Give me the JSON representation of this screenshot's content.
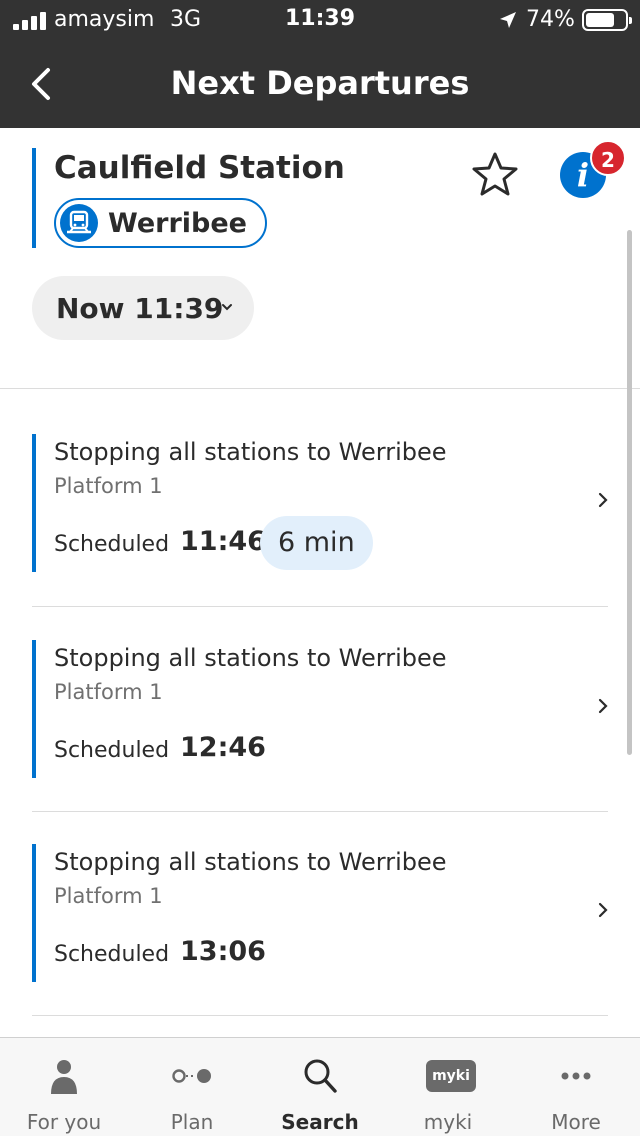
{
  "status_bar": {
    "carrier": "amaysim",
    "network": "3G",
    "time": "11:39",
    "battery": "74%",
    "battery_level": 0.74
  },
  "header": {
    "title": "Next Departures",
    "back_icon": "chevron-left-icon"
  },
  "station": {
    "name": "Caulfield Station",
    "route": "Werribee",
    "route_icon": "train-icon",
    "favourite_icon": "star-icon",
    "info_icon": "info-icon",
    "alerts_count": "2"
  },
  "time_filter": {
    "label": "Now 11:39"
  },
  "departures": [
    {
      "destination": "Stopping all stations to Werribee",
      "platform": "Platform 1",
      "scheduled_label": "Scheduled",
      "time": "11:46",
      "countdown": "6 min"
    },
    {
      "destination": "Stopping all stations to Werribee",
      "platform": "Platform 1",
      "scheduled_label": "Scheduled",
      "time": "12:46"
    },
    {
      "destination": "Stopping all stations to Werribee",
      "platform": "Platform 1",
      "scheduled_label": "Scheduled",
      "time": "13:06"
    }
  ],
  "tabs": [
    {
      "label": "For you",
      "icon": "person-icon"
    },
    {
      "label": "Plan",
      "icon": "journey-icon"
    },
    {
      "label": "Search",
      "icon": "search-icon",
      "active": true
    },
    {
      "label": "myki",
      "icon": "myki-card-icon",
      "chip_text": "myki"
    },
    {
      "label": "More",
      "icon": "more-icon"
    }
  ],
  "colors": {
    "header_bg": "#333333",
    "accent": "#0072ce",
    "badge": "#d7262e",
    "countdown_bg": "#e2effb"
  }
}
